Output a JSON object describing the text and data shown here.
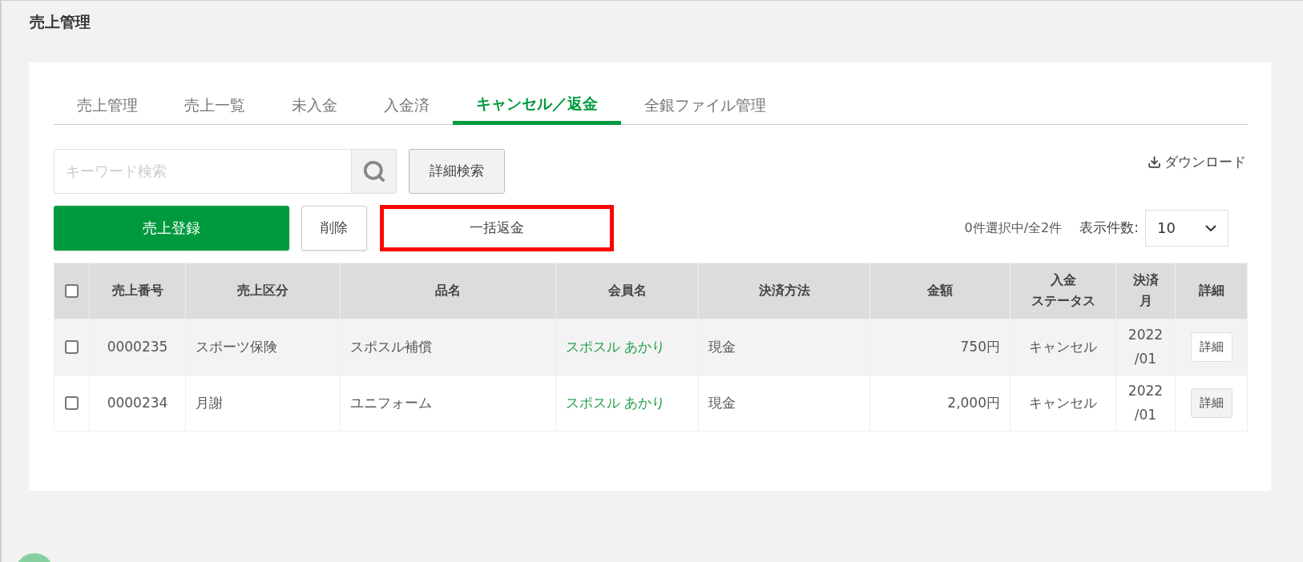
{
  "page_title": "売上管理",
  "tabs": [
    {
      "label": "売上管理",
      "selected": false
    },
    {
      "label": "売上一覧",
      "selected": false
    },
    {
      "label": "未入金",
      "selected": false
    },
    {
      "label": "入金済",
      "selected": false
    },
    {
      "label": "キャンセル／返金",
      "selected": true
    },
    {
      "label": "全銀ファイル管理",
      "selected": false
    }
  ],
  "search": {
    "placeholder": "キーワード検索"
  },
  "detail_search_button": "詳細検索",
  "download_link": "ダウンロード",
  "register_button": "売上登録",
  "delete_button": "削除",
  "bulk_refund_button": {
    "label": "一括返金",
    "highlighted": true
  },
  "selection_count": "0件選択中/全2件",
  "per_page": {
    "label": "表示件数:",
    "value": "10"
  },
  "table": {
    "select_all_checked": false,
    "columns": [
      {
        "lines": [
          "売上番号"
        ]
      },
      {
        "lines": [
          "売上区分"
        ]
      },
      {
        "lines": [
          "品名"
        ]
      },
      {
        "lines": [
          "会員名"
        ]
      },
      {
        "lines": [
          "決済方法"
        ]
      },
      {
        "lines": [
          "金額"
        ]
      },
      {
        "lines": [
          "入金",
          "ステータス"
        ]
      },
      {
        "lines": [
          "決済",
          "月"
        ]
      },
      {
        "lines": [
          "詳細"
        ]
      }
    ],
    "rows": [
      {
        "checked": false,
        "cells": [
          "0000235",
          "スポーツ保険",
          "スポスル補償",
          "スポスル あかり",
          "現金",
          "750円",
          "キャンセル",
          "2022\n/01"
        ],
        "detail_button": "詳細"
      },
      {
        "checked": false,
        "cells": [
          "0000234",
          "月謝",
          "ユニフォーム",
          "スポスル あかり",
          "現金",
          "2,000円",
          "キャンセル",
          "2022\n/01"
        ],
        "detail_button": "詳細"
      }
    ]
  }
}
